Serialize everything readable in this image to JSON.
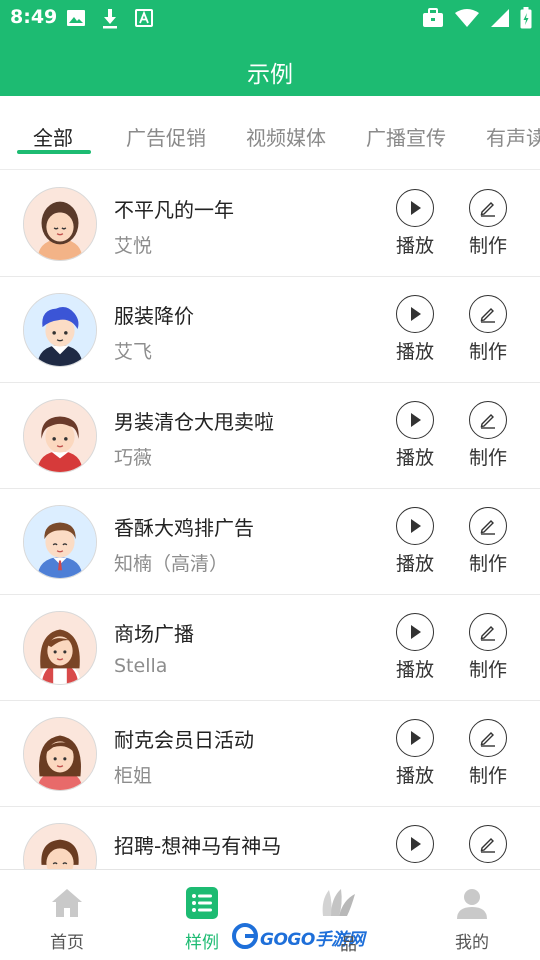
{
  "status_bar": {
    "time": "8:49",
    "left_icons": [
      "image-icon",
      "download-icon",
      "font-icon"
    ],
    "right_icons": [
      "briefcase-icon",
      "wifi-icon",
      "signal-icon",
      "battery-icon"
    ]
  },
  "app_bar": {
    "title": "示例"
  },
  "tabs": [
    {
      "label": "全部",
      "active": true
    },
    {
      "label": "广告促销",
      "active": false
    },
    {
      "label": "视频媒体",
      "active": false
    },
    {
      "label": "广播宣传",
      "active": false
    },
    {
      "label": "有声读",
      "active": false
    }
  ],
  "actions": {
    "play_label": "播放",
    "make_label": "制作"
  },
  "items": [
    {
      "title": "不平凡的一年",
      "voice": "艾悦",
      "avatar": "avatar-girl-bangs"
    },
    {
      "title": "服装降价",
      "voice": "艾飞",
      "avatar": "avatar-boy-blue-hair"
    },
    {
      "title": "男装清仓大甩卖啦",
      "voice": "巧薇",
      "avatar": "avatar-girl-red"
    },
    {
      "title": "香酥大鸡排广告",
      "voice": "知楠（高清）",
      "avatar": "avatar-boy-suit"
    },
    {
      "title": "商场广播",
      "voice": "Stella",
      "avatar": "avatar-woman-brown-hair"
    },
    {
      "title": "耐克会员日活动",
      "voice": "柜姐",
      "avatar": "avatar-woman-pink"
    },
    {
      "title": "招聘-想神马有神马",
      "voice": "",
      "avatar": "avatar-girl-smile"
    }
  ],
  "bottom_nav": [
    {
      "label": "首页",
      "icon": "home-icon",
      "active": false
    },
    {
      "label": "样例",
      "icon": "list-icon",
      "active": true
    },
    {
      "label": "品",
      "icon": "works-icon",
      "active": false
    },
    {
      "label": "我的",
      "icon": "profile-icon",
      "active": false
    }
  ],
  "watermark": {
    "text": "GOGO手游网"
  },
  "colors": {
    "accent": "#1dbb72",
    "text": "#222222",
    "muted": "#8d8d8d"
  }
}
